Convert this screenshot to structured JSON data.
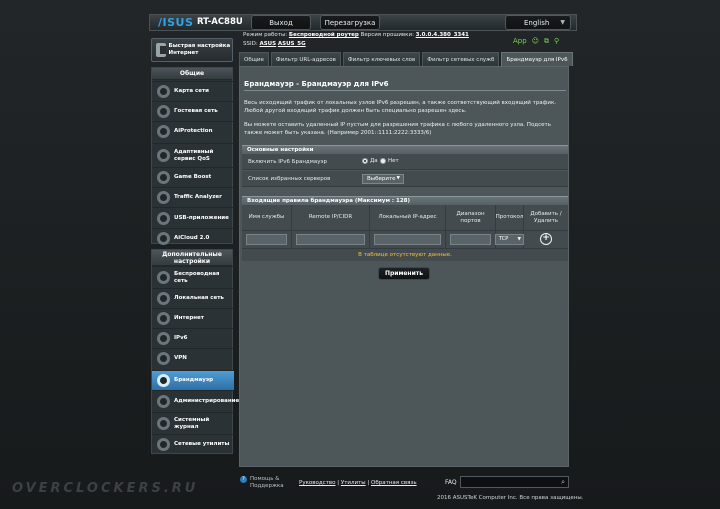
{
  "header": {
    "brand": "/ISUS",
    "model": "RT-AC88U",
    "logout_label": "Выход",
    "reboot_label": "Перезагрузка",
    "language": "English",
    "mode_label": "Режим работы:",
    "mode_value": "Беспроводной роутер",
    "firmware_label": "Версия прошивки:",
    "firmware_value": "3.0.0.4.380_3341",
    "ssid_label": "SSID:",
    "ssid_values": [
      "ASUS",
      "ASUS_5G"
    ],
    "status_app": "App"
  },
  "sidebar": {
    "quick_setup": "Быстрая настройка Интернет",
    "general_title": "Общие",
    "general_items": [
      {
        "label": "Карта сети",
        "icon": "network-map-icon"
      },
      {
        "label": "Гостевая сеть",
        "icon": "guest-network-icon"
      },
      {
        "label": "AiProtection",
        "icon": "aiprotection-icon"
      },
      {
        "label": "Адаптивный сервис QoS",
        "icon": "qos-icon"
      },
      {
        "label": "Game Boost",
        "icon": "game-boost-icon"
      },
      {
        "label": "Traffic Analyzer",
        "icon": "traffic-analyzer-icon"
      },
      {
        "label": "USB-приложение",
        "icon": "usb-icon"
      },
      {
        "label": "AiCloud 2.0",
        "icon": "aicloud-icon"
      }
    ],
    "advanced_title": "Дополнительные настройки",
    "advanced_items": [
      {
        "label": "Беспроводная сеть",
        "icon": "wireless-icon"
      },
      {
        "label": "Локальная сеть",
        "icon": "lan-icon"
      },
      {
        "label": "Интернет",
        "icon": "wan-icon"
      },
      {
        "label": "IPv6",
        "icon": "ipv6-icon"
      },
      {
        "label": "VPN",
        "icon": "vpn-icon"
      },
      {
        "label": "Брандмауэр",
        "icon": "firewall-icon"
      },
      {
        "label": "Администрирование",
        "icon": "administration-icon"
      },
      {
        "label": "Системный журнал",
        "icon": "system-log-icon"
      },
      {
        "label": "Сетевые утилиты",
        "icon": "network-tools-icon"
      }
    ]
  },
  "tabs": [
    "Общие",
    "Фильтр URL-адресов",
    "Фильтр ключевых слов",
    "Фильтр сетевых служб",
    "Брандмауэр для IPv6"
  ],
  "main": {
    "title": "Брандмауэр - Брандмауэр для IPv6",
    "desc1": "Весь исходящий трафик от локальных узлов IPv6 разрешен, а также соответствующий входящий трафик. Любой другой входящий трафик должен быть специально разрешен здесь.",
    "desc2": "Вы можете оставить удаленный IP пустым для разрешения трафика с любого удаленного узла. Подсеть также может быть указана. (Например 2001::1111:2222:3333/6)",
    "basic_title": "Основные настройки",
    "enable_label": "Включить IPv6 Брандмауэр",
    "yes_label": "Да",
    "no_label": "Нет",
    "fav_label": "Список избранных серверов",
    "fav_value": "Выберите",
    "rules_title": "Входящие правила брандмауэра (Максимум : 128)",
    "columns": [
      "Имя службы",
      "Remote IP/CIDR",
      "Локальный IP-адрес",
      "Диапазон портов",
      "Протокол",
      "Добавить / Удалить"
    ],
    "protocol_value": "TCP",
    "empty_text": "В таблице отсутствуют данные.",
    "apply_label": "Применить"
  },
  "footer": {
    "help": "Помощь & Поддержка",
    "links": [
      "Руководство",
      "Утилиты",
      "Обратная связь"
    ],
    "faq": "FAQ",
    "copyright": "2016 ASUSTeK Computer Inc. Все права защищены.",
    "watermark": "OVERCLOCKERS.RU"
  }
}
